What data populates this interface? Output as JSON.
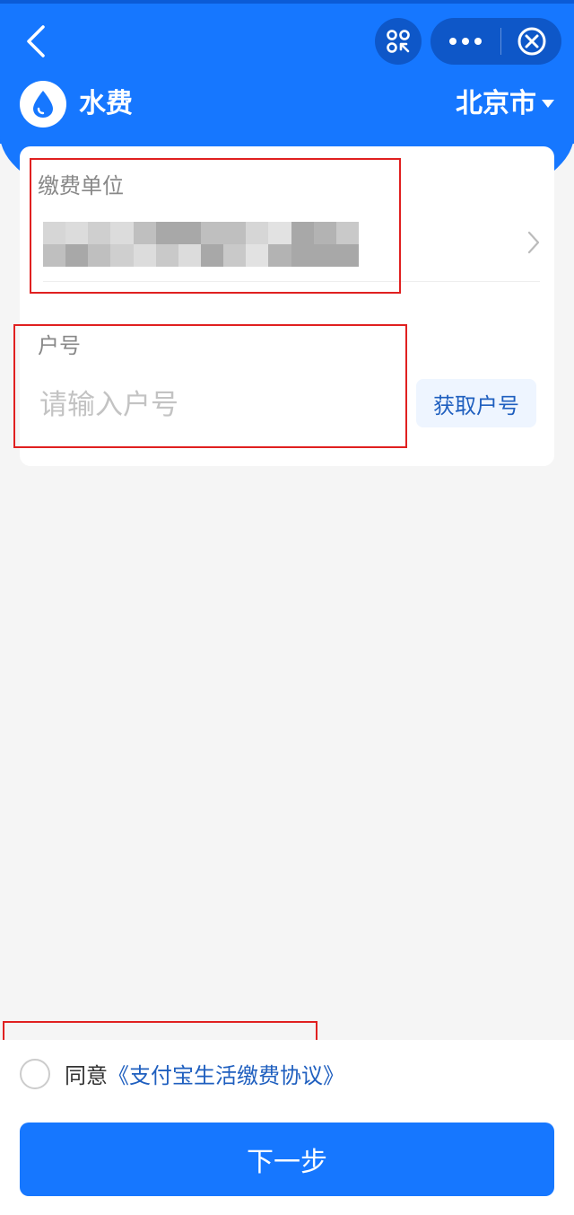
{
  "header": {
    "title": "水费",
    "city": "北京市"
  },
  "form": {
    "unit_label": "缴费单位",
    "account_label": "户号",
    "account_placeholder": "请输入户号",
    "account_value": "",
    "get_account_button": "获取户号"
  },
  "footer": {
    "agree_prefix": "同意",
    "agreement_link": "《支付宝生活缴费协议》",
    "next_button": "下一步"
  },
  "colors": {
    "brand": "#1677ff",
    "link": "#1f5fbf",
    "annotation": "#e02020"
  },
  "icons": {
    "back": "chevron-left-icon",
    "scan": "scan-icon",
    "more": "more-icon",
    "close": "close-circle-icon",
    "logo": "water-drop-icon",
    "city_dropdown": "caret-down-icon",
    "unit_select": "chevron-right-icon"
  }
}
